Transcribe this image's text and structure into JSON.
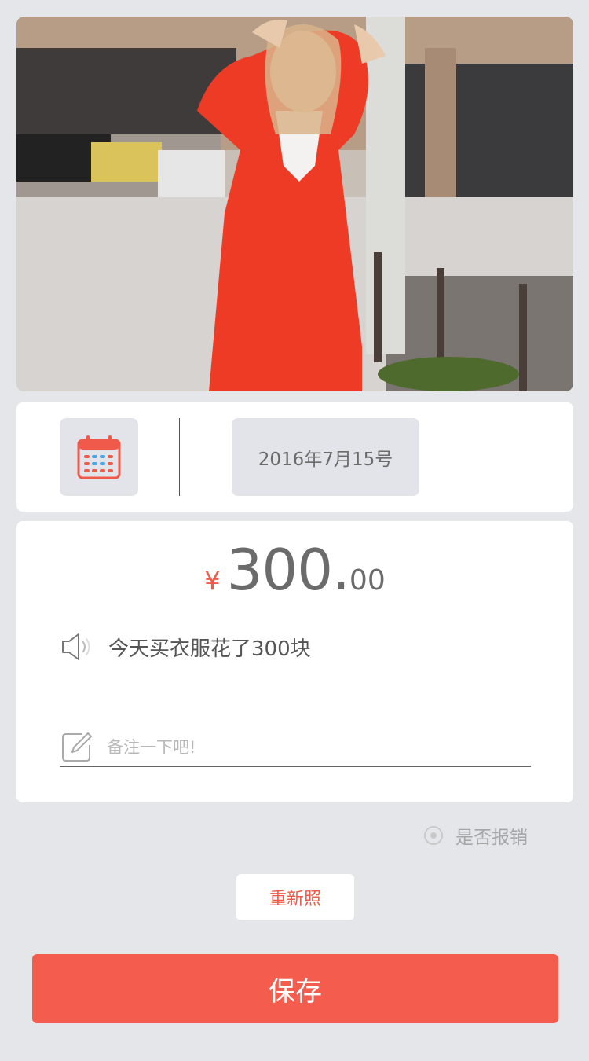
{
  "photo": {
    "description_icon": "photo-image"
  },
  "date_card": {
    "calendar_icon": "calendar-icon",
    "date_label": "2016年7月15号"
  },
  "amount_card": {
    "currency_symbol": "¥",
    "amount_integer": "300.",
    "amount_decimal": "00",
    "voice_icon": "speaker-icon",
    "voice_text": "今天买衣服花了300块",
    "note_icon": "edit-icon",
    "note_placeholder": "备注一下吧!",
    "note_value": ""
  },
  "reimburse": {
    "label": "是否报销",
    "checked": false
  },
  "buttons": {
    "retake_label": "重新照",
    "save_label": "保存"
  },
  "colors": {
    "accent": "#f45d4e",
    "background": "#e5e6ea",
    "card": "#ffffff"
  }
}
